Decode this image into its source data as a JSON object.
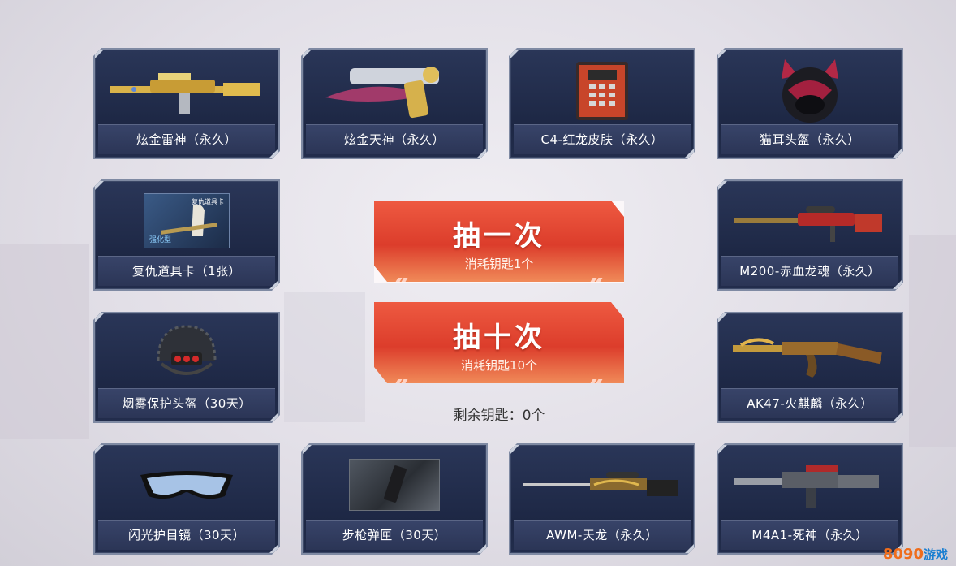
{
  "prizes": [
    {
      "name": "炫金雷神（永久）",
      "icon": "rifle-gold-icon"
    },
    {
      "name": "炫金天神（永久）",
      "icon": "pistol-gold-icon"
    },
    {
      "name": "C4-红龙皮肤（永久）",
      "icon": "c4-bomb-icon"
    },
    {
      "name": "猫耳头盔（永久）",
      "icon": "cat-helmet-icon"
    },
    {
      "name": "复仇道具卡（1张）",
      "icon": "item-card-icon",
      "card_text": "复仇道具卡",
      "card_sub": "强化型"
    },
    {
      "name": "M200-赤血龙魂（永久）",
      "icon": "sniper-red-icon"
    },
    {
      "name": "烟雾保护头盔（30天）",
      "icon": "smoke-helmet-icon"
    },
    {
      "name": "AK47-火麒麟（永久）",
      "icon": "ak47-icon"
    },
    {
      "name": "闪光护目镜（30天）",
      "icon": "goggles-icon"
    },
    {
      "name": "步枪弹匣（30天）",
      "icon": "magazine-icon"
    },
    {
      "name": "AWM-天龙（永久）",
      "icon": "awm-icon"
    },
    {
      "name": "M4A1-死神（永久）",
      "icon": "m4a1-icon"
    }
  ],
  "draw_once": {
    "label": "抽一次",
    "cost": "消耗钥匙1个"
  },
  "draw_ten": {
    "label": "抽十次",
    "cost": "消耗钥匙10个"
  },
  "remaining_keys": "剩余钥匙：0个",
  "watermark": {
    "number": "8090",
    "text": "游戏"
  },
  "colors": {
    "card_bg": "#1d2744",
    "card_border": "#7f8aa3",
    "button_red": "#dc3d2b"
  }
}
